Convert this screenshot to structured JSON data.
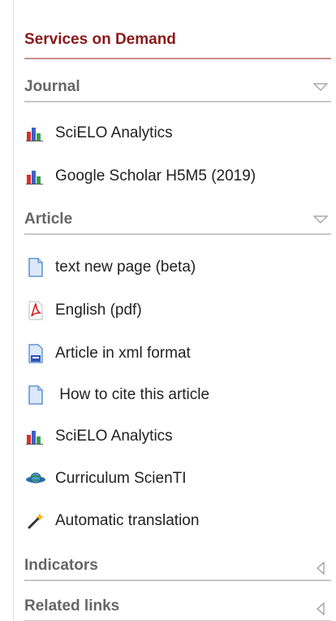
{
  "panel": {
    "title": "Services on Demand"
  },
  "sections": {
    "journal": {
      "label": "Journal",
      "items": [
        {
          "label": "SciELO Analytics",
          "icon": "bar-chart-icon"
        },
        {
          "label": "Google Scholar H5M5 (2019)",
          "icon": "bar-chart-icon"
        }
      ]
    },
    "article": {
      "label": "Article",
      "items": [
        {
          "label": "text new page (beta)",
          "icon": "document-icon"
        },
        {
          "label": "English (pdf)",
          "icon": "pdf-icon"
        },
        {
          "label": "Article in xml format",
          "icon": "xml-file-icon"
        },
        {
          "label": " How to cite this article",
          "icon": "document-icon"
        },
        {
          "label": "SciELO Analytics",
          "icon": "bar-chart-icon"
        },
        {
          "label": "Curriculum ScienTI",
          "icon": "globe-icon"
        },
        {
          "label": "Automatic translation",
          "icon": "magic-wand-icon"
        }
      ]
    },
    "indicators": {
      "label": "Indicators"
    },
    "related_links": {
      "label": "Related links"
    }
  },
  "colors": {
    "title": "#8b1a1a",
    "section_label": "#666666",
    "rule": "#c8c8c8"
  }
}
